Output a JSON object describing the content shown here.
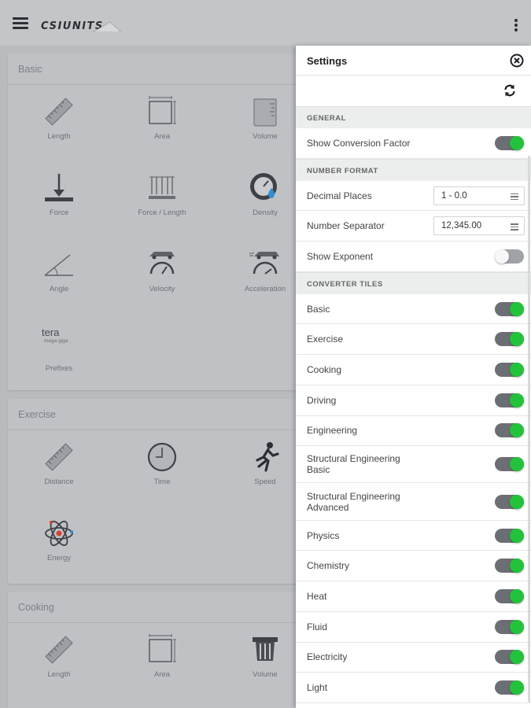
{
  "app": {
    "logo_text": "CSIUNITS"
  },
  "cards": {
    "basic": {
      "title": "Basic",
      "tiles": [
        "Length",
        "Area",
        "Volume",
        "Force",
        "Force / Length",
        "Density",
        "Angle",
        "Velocity",
        "Acceleration",
        "Prefixes"
      ]
    },
    "exercise": {
      "title": "Exercise",
      "tiles": [
        "Distance",
        "Time",
        "Speed",
        "Energy"
      ]
    },
    "cooking": {
      "title": "Cooking",
      "tiles": [
        "Length",
        "Area",
        "Volume"
      ]
    },
    "prefix_icon": {
      "main": "tera",
      "sub": "mega giga"
    }
  },
  "settings": {
    "title": "Settings",
    "sections": {
      "general": "GENERAL",
      "number_format": "NUMBER FORMAT",
      "converter_tiles": "CONVERTER TILES"
    },
    "general": {
      "show_conversion_factor": {
        "label": "Show Conversion Factor",
        "on": true
      }
    },
    "number_format": {
      "decimal_places": {
        "label": "Decimal Places",
        "value": "1 - 0.0"
      },
      "number_separator": {
        "label": "Number Separator",
        "value": "12,345.00"
      },
      "show_exponent": {
        "label": "Show Exponent",
        "on": false
      }
    },
    "tiles": [
      {
        "label": "Basic",
        "on": true
      },
      {
        "label": "Exercise",
        "on": true
      },
      {
        "label": "Cooking",
        "on": true
      },
      {
        "label": "Driving",
        "on": true
      },
      {
        "label": "Engineering",
        "on": true
      },
      {
        "label": "Structural Engineering Basic",
        "on": true
      },
      {
        "label": "Structural Engineering Advanced",
        "on": true
      },
      {
        "label": "Physics",
        "on": true
      },
      {
        "label": "Chemistry",
        "on": true
      },
      {
        "label": "Heat",
        "on": true
      },
      {
        "label": "Fluid",
        "on": true
      },
      {
        "label": "Electricity",
        "on": true
      },
      {
        "label": "Light",
        "on": true
      }
    ]
  },
  "colors": {
    "toggle_on": "#22c33b",
    "toggle_track": "#6b6e73",
    "overlay": "#b9bcbf"
  }
}
